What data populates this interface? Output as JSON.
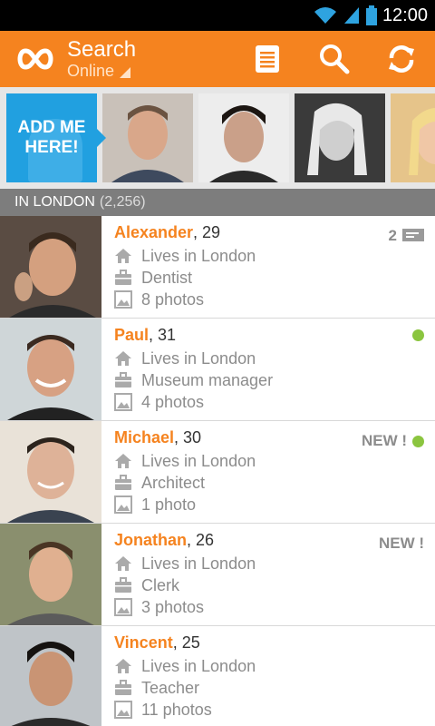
{
  "status": {
    "time": "12:00"
  },
  "appbar": {
    "title": "Search",
    "subtitle": "Online"
  },
  "strip": {
    "add_me": [
      "ADD ME",
      "HERE!"
    ]
  },
  "section": {
    "label": "IN LONDON",
    "count": "(2,256)"
  },
  "people": [
    {
      "name": "Alexander",
      "age": ", 29",
      "lives": "Lives in London",
      "job": "Dentist",
      "photos": "8 photos",
      "badge_text": "2",
      "online": false,
      "messages": true
    },
    {
      "name": "Paul",
      "age": ", 31",
      "lives": "Lives in London",
      "job": "Museum manager",
      "photos": "4 photos",
      "badge_text": "",
      "online": true,
      "messages": false
    },
    {
      "name": "Michael",
      "age": ", 30",
      "lives": "Lives in London",
      "job": "Architect",
      "photos": "1 photo",
      "badge_text": "NEW !",
      "online": true,
      "messages": false
    },
    {
      "name": "Jonathan",
      "age": ", 26",
      "lives": "Lives in London",
      "job": "Clerk",
      "photos": "3 photos",
      "badge_text": "NEW !",
      "online": false,
      "messages": false
    },
    {
      "name": "Vincent",
      "age": ", 25",
      "lives": "Lives in London",
      "job": "Teacher",
      "photos": "11 photos",
      "badge_text": "",
      "online": false,
      "messages": false
    }
  ],
  "colors": {
    "accent": "#f5831f",
    "section_bg": "#7d7d7d",
    "online": "#8bc53f",
    "add_me": "#21a0e0"
  }
}
